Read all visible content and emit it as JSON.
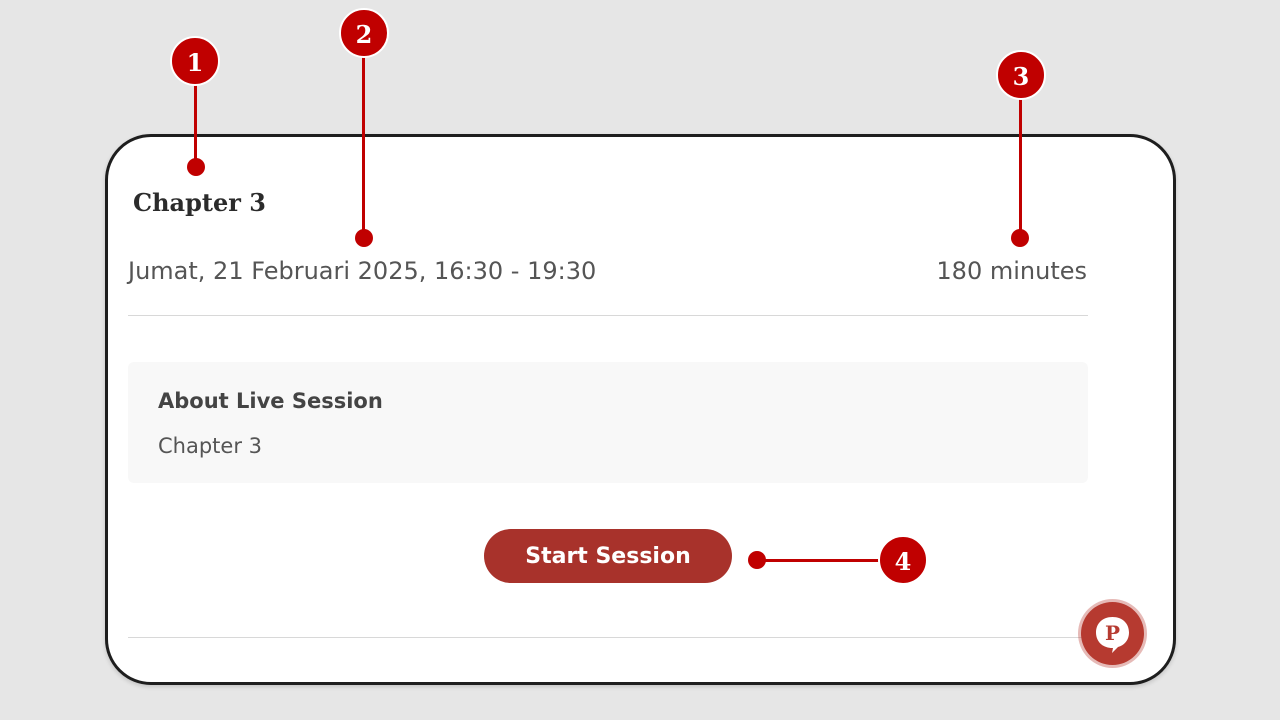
{
  "session": {
    "title": "Chapter 3",
    "schedule": "Jumat, 21 Februari 2025, 16:30 - 19:30",
    "duration": "180 minutes",
    "about_heading": "About Live Session",
    "about_body": "Chapter 3",
    "start_button_label": "Start Session"
  },
  "chat_fab": {
    "icon": "chat-bubble-p-icon",
    "letter": "P"
  },
  "callouts": {
    "marker_1": "1",
    "marker_2": "2",
    "marker_3": "3",
    "marker_4": "4"
  },
  "colors": {
    "accent": "#a8322b",
    "callout": "#c00000",
    "background": "#e6e6e6"
  }
}
